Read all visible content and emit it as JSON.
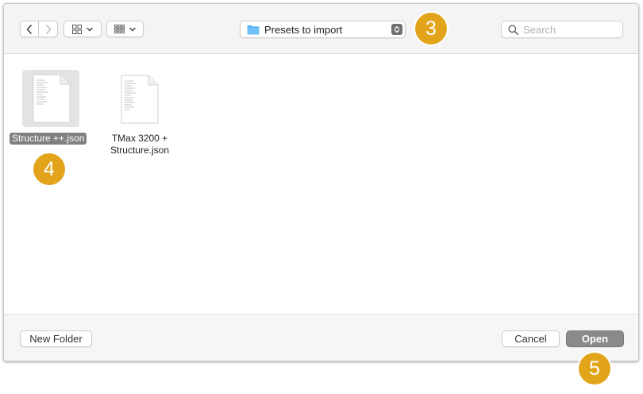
{
  "toolbar": {
    "back_icon": "chevron-left-icon",
    "forward_icon": "chevron-right-icon",
    "view_icons_icon": "icon-grid-icon",
    "view_group_icon": "group-grid-icon",
    "path": {
      "label": "Presets to import",
      "icon": "folder-icon",
      "stepper_icon": "up-down-chevron-icon"
    },
    "search": {
      "placeholder": "Search",
      "icon": "search-icon"
    }
  },
  "files": [
    {
      "name": "Structure ++.json",
      "selected": true,
      "icon": "json-file-icon"
    },
    {
      "name_line1": "TMax 3200 +",
      "name_line2": "Structure.json",
      "selected": false,
      "icon": "json-file-icon"
    }
  ],
  "footer": {
    "new_folder_label": "New Folder",
    "cancel_label": "Cancel",
    "open_label": "Open"
  },
  "callouts": [
    "3",
    "4",
    "5"
  ],
  "colors": {
    "callout": "#e2a41b",
    "selection": "#808080",
    "folder": "#5fb2f2",
    "open_button": "#8a8a8a"
  }
}
